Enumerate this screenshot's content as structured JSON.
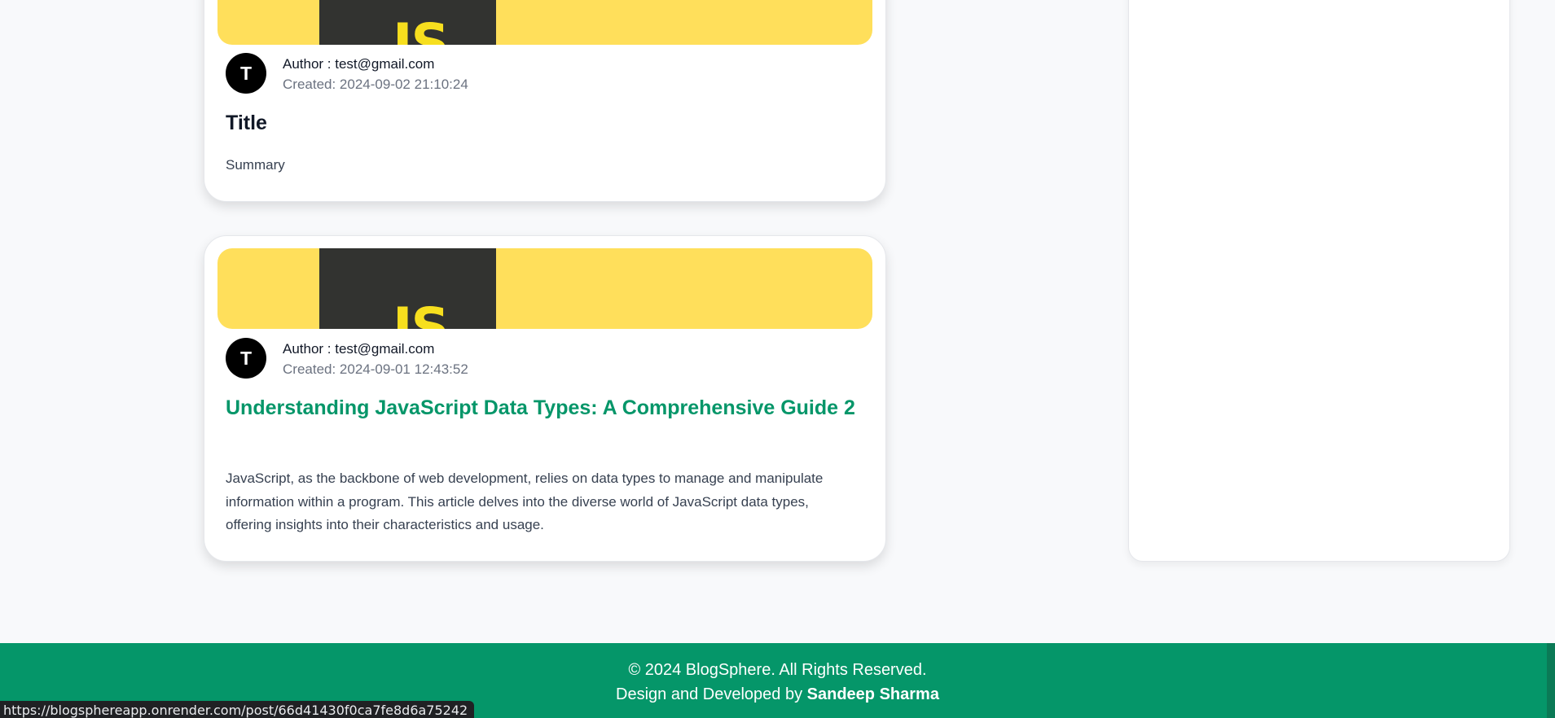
{
  "posts": [
    {
      "banner_text": "JS",
      "avatar_letter": "T",
      "author": "Author : test@gmail.com",
      "created": "Created: 2024-09-02 21:10:24",
      "title": "Title",
      "summary": "Summary"
    },
    {
      "banner_text": "JS",
      "avatar_letter": "T",
      "author": "Author : test@gmail.com",
      "created": "Created: 2024-09-01 12:43:52",
      "title": "Understanding JavaScript Data Types: A Comprehensive Guide 2",
      "summary": "JavaScript, as the backbone of web development, relies on data types to manage and manipulate information within a program. This article delves into the diverse world of JavaScript data types, offering insights into their characteristics and usage."
    }
  ],
  "footer": {
    "copyright": "© 2024 BlogSphere. All Rights Reserved.",
    "credit_prefix": "Design and Developed by ",
    "credit_name": "Sandeep Sharma"
  },
  "status_bar": {
    "url": "https://blogsphereapp.onrender.com/post/66d41430f0ca7fe8d6a75242"
  },
  "colors": {
    "accent": "#059669",
    "banner_yellow": "#ffdf5b",
    "banner_dark": "#323330"
  }
}
